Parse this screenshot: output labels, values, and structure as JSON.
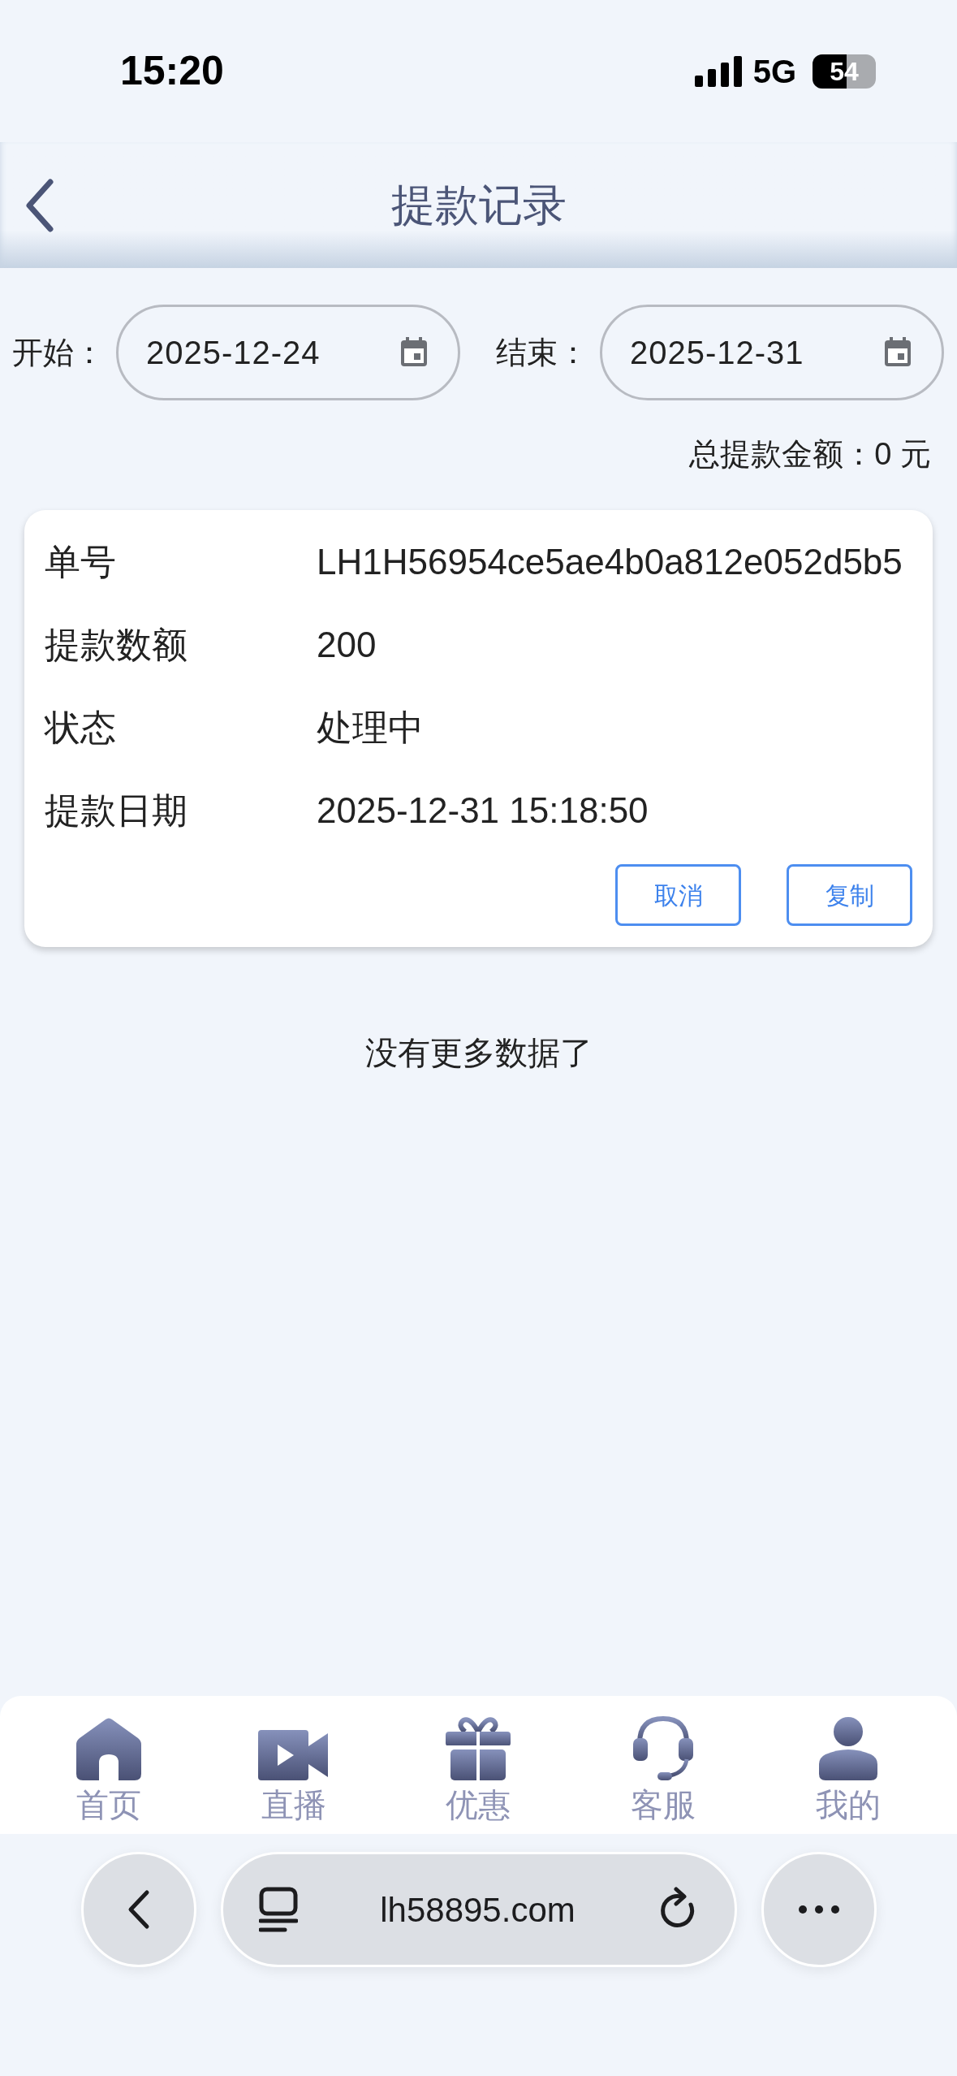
{
  "status_bar": {
    "time": "15:20",
    "network": "5G",
    "battery": "54"
  },
  "header": {
    "title": "提款记录"
  },
  "filter": {
    "start_label": "开始：",
    "start_date": "2025-12-24",
    "end_label": "结束：",
    "end_date": "2025-12-31"
  },
  "total": "总提款金额：0 元",
  "records": [
    {
      "fields": [
        {
          "label": "单号",
          "value": "LH1H56954ce5ae4b0a812e052d5b5"
        },
        {
          "label": "提款数额",
          "value": "200"
        },
        {
          "label": "状态",
          "value": "处理中"
        },
        {
          "label": "提款日期",
          "value": "2025-12-31 15:18:50"
        }
      ],
      "buttons": [
        "取消",
        "复制"
      ]
    }
  ],
  "footer_note": "没有更多数据了",
  "tab_bar": {
    "items": [
      {
        "label": "首页"
      },
      {
        "label": "直播"
      },
      {
        "label": "优惠"
      },
      {
        "label": "客服"
      },
      {
        "label": "我的"
      }
    ]
  },
  "browser": {
    "url": "lh58895.com"
  }
}
